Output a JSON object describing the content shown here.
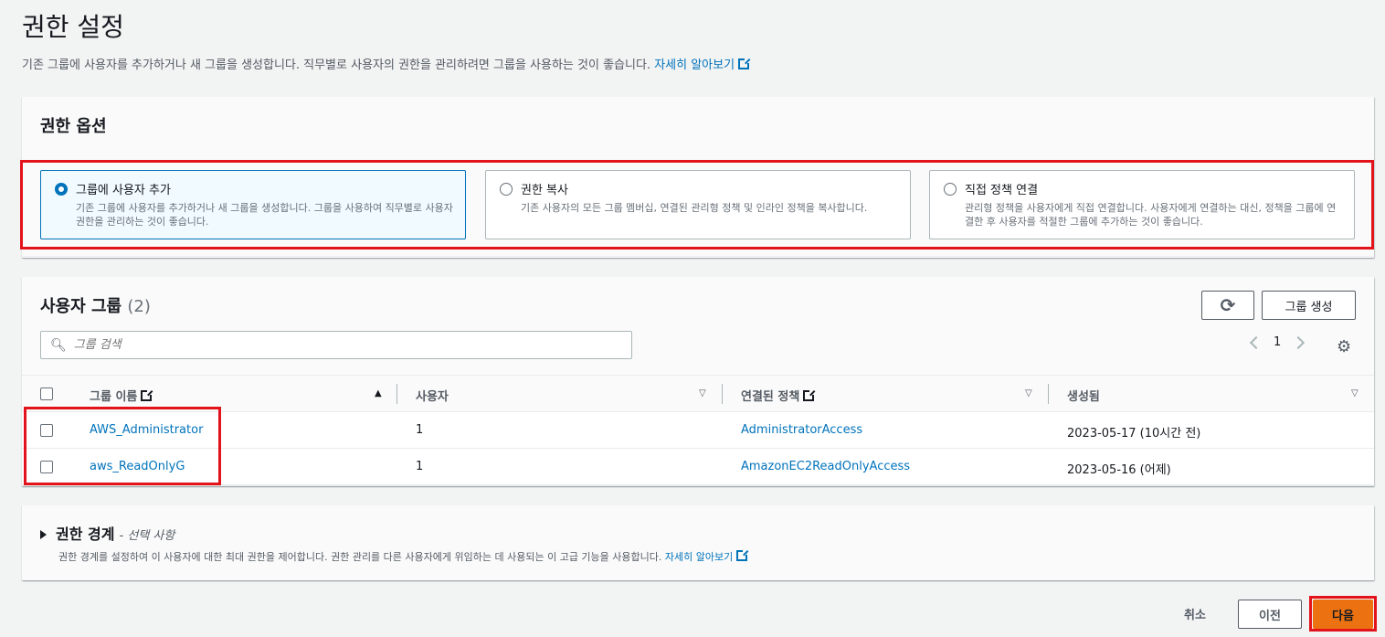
{
  "page": {
    "title": "권한 설정",
    "description": "기존 그룹에 사용자를 추가하거나 새 그룹을 생성합니다. 직무별로 사용자의 권한을 관리하려면 그룹을 사용하는 것이 좋습니다.",
    "learn_more": "자세히 알아보기"
  },
  "permission_options": {
    "title": "권한 옵션",
    "options": [
      {
        "label": "그룹에 사용자 추가",
        "description": "기존 그룹에 사용자를 추가하거나 새 그룹을 생성합니다. 그룹을 사용하여 직무별로 사용자 권한을 관리하는 것이 좋습니다.",
        "selected": true
      },
      {
        "label": "권한 복사",
        "description": "기존 사용자의 모든 그룹 멤버십, 연결된 관리형 정책 및 인라인 정책을 복사합니다.",
        "selected": false
      },
      {
        "label": "직접 정책 연결",
        "description": "관리형 정책을 사용자에게 직접 연결합니다. 사용자에게 연결하는 대신, 정책을 그룹에 연결한 후 사용자를 적절한 그룹에 추가하는 것이 좋습니다.",
        "selected": false
      }
    ]
  },
  "user_groups": {
    "title": "사용자 그룹",
    "count": "(2)",
    "create_button": "그룹 생성",
    "search_placeholder": "그룹 검색",
    "page_number": "1",
    "columns": [
      "그룹 이름",
      "사용자",
      "연결된 정책",
      "생성됨"
    ],
    "rows": [
      {
        "name": "AWS_Administrator",
        "users": "1",
        "policy": "AdministratorAccess",
        "created": "2023-05-17 (10시간 전)"
      },
      {
        "name": "aws_ReadOnlyG",
        "users": "1",
        "policy": "AmazonEC2ReadOnlyAccess",
        "created": "2023-05-16 (어제)"
      }
    ]
  },
  "boundary": {
    "title": "권한 경계",
    "optional": "- 선택 사항",
    "description": "권한 경계를 설정하여 이 사용자에 대한 최대 권한을 제어합니다. 권한 관리를 다른 사용자에게 위임하는 데 사용되는 이 고급 기능을 사용합니다.",
    "learn_more": "자세히 알아보기"
  },
  "footer": {
    "cancel": "취소",
    "previous": "이전",
    "next": "다음"
  },
  "colors": {
    "link": "#0073bb",
    "primary_button": "#ec7211",
    "highlight_outline": "#e3131b"
  }
}
